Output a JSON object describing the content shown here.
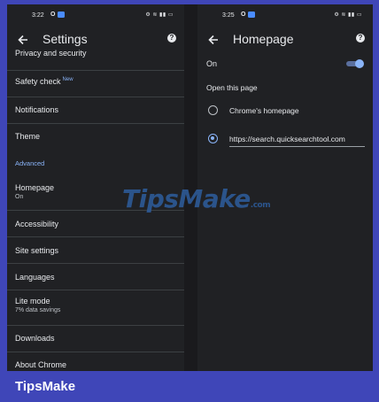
{
  "left_screen": {
    "status": {
      "time": "3:22",
      "carrier_icon": "O",
      "right": "⚙ ≋ ▮▮ ▭"
    },
    "title": "Settings",
    "partial_row": "Privacy and security",
    "items": [
      {
        "title": "Safety check",
        "badge": "New"
      },
      {
        "title": "Notifications"
      },
      {
        "title": "Theme"
      },
      {
        "section": "Advanced"
      },
      {
        "title": "Homepage",
        "subtitle": "On"
      },
      {
        "title": "Accessibility"
      },
      {
        "title": "Site settings"
      },
      {
        "title": "Languages"
      },
      {
        "title": "Lite mode",
        "subtitle": "7% data savings"
      },
      {
        "title": "Downloads"
      },
      {
        "title": "About Chrome"
      }
    ]
  },
  "right_screen": {
    "status": {
      "time": "3:25",
      "carrier_icon": "O",
      "right": "⚙ ≋ ▮▮ ▭"
    },
    "title": "Homepage",
    "on_label": "On",
    "toggle_on": true,
    "section_label": "Open this page",
    "option_chrome": "Chrome's homepage",
    "option_custom_url": "https://search.quicksearchtool.com",
    "selected": "custom"
  },
  "watermark": {
    "main": "TipsMake",
    "domain": ".com"
  },
  "brand": "TipsMake",
  "colors": {
    "accent": "#8ab4f8",
    "background": "#202124",
    "brand_bar": "#3f46b8"
  }
}
